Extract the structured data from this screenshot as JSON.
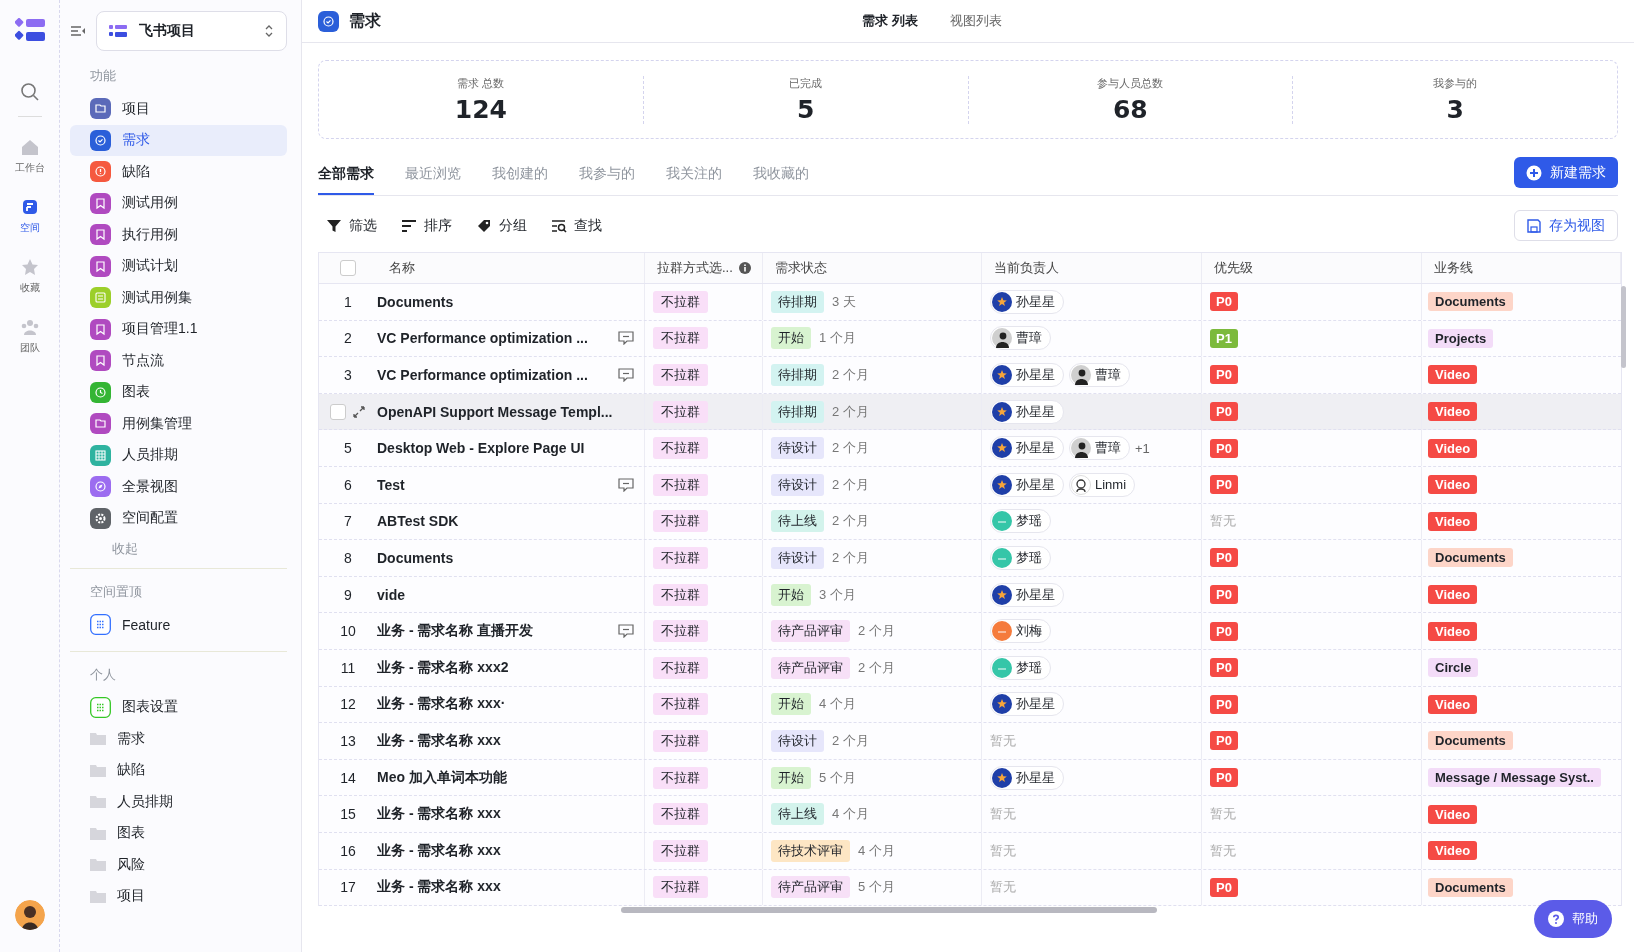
{
  "rail": {
    "items": [
      {
        "label": "工作台",
        "selected": false
      },
      {
        "label": "空间",
        "selected": true
      },
      {
        "label": "收藏",
        "selected": false
      },
      {
        "label": "团队",
        "selected": false
      }
    ]
  },
  "sidebar": {
    "project": "飞书项目",
    "sections": [
      {
        "title": "功能",
        "collapse": "收起",
        "items": [
          {
            "label": "项目",
            "kind": "badge",
            "color": "#5b6ab9",
            "selected": false
          },
          {
            "label": "需求",
            "kind": "badge",
            "color": "#2b5fd9",
            "selected": true
          },
          {
            "label": "缺陷",
            "kind": "badge",
            "color": "#f5593f",
            "selected": false
          },
          {
            "label": "测试用例",
            "kind": "badge",
            "color": "#b04ac0",
            "selected": false
          },
          {
            "label": "执行用例",
            "kind": "badge",
            "color": "#b04ac0",
            "selected": false
          },
          {
            "label": "测试计划",
            "kind": "badge",
            "color": "#b04ac0",
            "selected": false
          },
          {
            "label": "测试用例集",
            "kind": "badge",
            "color": "#9ccf2a",
            "selected": false
          },
          {
            "label": "项目管理1.1",
            "kind": "badge",
            "color": "#b04ac0",
            "selected": false
          },
          {
            "label": "节点流",
            "kind": "badge",
            "color": "#b04ac0",
            "selected": false
          },
          {
            "label": "图表",
            "kind": "badge",
            "color": "#34b534",
            "selected": false
          },
          {
            "label": "用例集管理",
            "kind": "badge",
            "color": "#b04ac0",
            "selected": false
          },
          {
            "label": "人员排期",
            "kind": "badge",
            "color": "#2fb3a0",
            "selected": false
          },
          {
            "label": "全景视图",
            "kind": "badge",
            "color": "#9c6cf0",
            "selected": false
          },
          {
            "label": "空间配置",
            "kind": "badge",
            "color": "#5f6368",
            "selected": false
          }
        ]
      },
      {
        "title": "空间置顶",
        "items": [
          {
            "label": "Feature",
            "kind": "list",
            "color": "#3370ff",
            "selected": false
          }
        ]
      },
      {
        "title": "个人",
        "items": [
          {
            "label": "图表设置",
            "kind": "list",
            "color": "#34c724",
            "selected": false
          },
          {
            "label": "需求",
            "kind": "folder",
            "selected": false
          },
          {
            "label": "缺陷",
            "kind": "folder",
            "selected": false
          },
          {
            "label": "人员排期",
            "kind": "folder",
            "selected": false
          },
          {
            "label": "图表",
            "kind": "folder",
            "selected": false
          },
          {
            "label": "风险",
            "kind": "folder",
            "selected": false
          },
          {
            "label": "项目",
            "kind": "folder",
            "selected": false
          }
        ]
      }
    ]
  },
  "header": {
    "title": "需求",
    "views": [
      {
        "label": "需求 列表",
        "selected": true
      },
      {
        "label": "视图列表",
        "selected": false
      }
    ]
  },
  "stats": [
    {
      "label": "需求 总数",
      "value": "124"
    },
    {
      "label": "已完成",
      "value": "5"
    },
    {
      "label": "参与人员总数",
      "value": "68"
    },
    {
      "label": "我参与的",
      "value": "3"
    }
  ],
  "tabs": [
    {
      "label": "全部需求",
      "selected": true
    },
    {
      "label": "最近浏览",
      "selected": false
    },
    {
      "label": "我创建的",
      "selected": false
    },
    {
      "label": "我参与的",
      "selected": false
    },
    {
      "label": "我关注的",
      "selected": false
    },
    {
      "label": "我收藏的",
      "selected": false
    }
  ],
  "new_button": "新建需求",
  "toolbar": {
    "tools": [
      "筛选",
      "排序",
      "分组",
      "查找"
    ],
    "save_view": "存为视图"
  },
  "table": {
    "all_checked": false,
    "columns": [
      {
        "label": "名称",
        "info": false
      },
      {
        "label": "拉群方式选...",
        "info": true
      },
      {
        "label": "需求状态",
        "info": false
      },
      {
        "label": "当前负责人",
        "info": false
      },
      {
        "label": "优先级",
        "info": false
      },
      {
        "label": "业务线",
        "info": false
      }
    ],
    "rows": [
      {
        "number": "1",
        "hovered": false,
        "name": "Documents",
        "comment": false,
        "group": "不拉群",
        "status": {
          "label": "待排期",
          "color": "#d3f3f1"
        },
        "duration": "3 天",
        "owners": [
          {
            "name": "孙星星",
            "kind": "star",
            "color": "#1f3fa8"
          }
        ],
        "priority": {
          "label": "P0",
          "kind": "p0"
        },
        "business": {
          "label": "Documents",
          "kind": "soft",
          "color": "#fdd5c8"
        }
      },
      {
        "number": "2",
        "hovered": false,
        "name": "VC Performance optimization ...",
        "comment": true,
        "group": "不拉群",
        "status": {
          "label": "开始",
          "color": "#d8f3d0"
        },
        "duration": "1 个月",
        "owners": [
          {
            "name": "曹璋",
            "kind": "photo",
            "color": "#cfcfcf"
          }
        ],
        "priority": {
          "label": "P1",
          "kind": "p1"
        },
        "business": {
          "label": "Projects",
          "kind": "soft",
          "color": "#f3dcf8"
        }
      },
      {
        "number": "3",
        "hovered": false,
        "name": "VC Performance optimization ...",
        "comment": true,
        "group": "不拉群",
        "status": {
          "label": "待排期",
          "color": "#d3f3f1"
        },
        "duration": "2 个月",
        "owners": [
          {
            "name": "孙星星",
            "kind": "star",
            "color": "#1f3fa8"
          },
          {
            "name": "曹璋",
            "kind": "photo",
            "color": "#cfcfcf"
          }
        ],
        "priority": {
          "label": "P0",
          "kind": "p0"
        },
        "business": {
          "label": "Video",
          "kind": "solid",
          "color": "#f54a45"
        }
      },
      {
        "hovered": true,
        "checked": false,
        "name": "OpenAPI Support Message Templ...",
        "comment": false,
        "group": "不拉群",
        "status": {
          "label": "待排期",
          "color": "#d3f3f1"
        },
        "duration": "2 个月",
        "owners": [
          {
            "name": "孙星星",
            "kind": "star",
            "color": "#1f3fa8"
          }
        ],
        "priority": {
          "label": "P0",
          "kind": "p0"
        },
        "business": {
          "label": "Video",
          "kind": "solid",
          "color": "#f54a45"
        }
      },
      {
        "number": "5",
        "hovered": false,
        "name": "Desktop Web - Explore Page UI",
        "comment": false,
        "group": "不拉群",
        "status": {
          "label": "待设计",
          "color": "#e6e6fb"
        },
        "duration": "2 个月",
        "owners": [
          {
            "name": "孙星星",
            "kind": "star",
            "color": "#1f3fa8"
          },
          {
            "name": "曹璋",
            "kind": "photo",
            "color": "#cfcfcf"
          }
        ],
        "more": "+1",
        "priority": {
          "label": "P0",
          "kind": "p0"
        },
        "business": {
          "label": "Video",
          "kind": "solid",
          "color": "#f54a45"
        }
      },
      {
        "number": "6",
        "hovered": false,
        "name": "Test",
        "comment": true,
        "group": "不拉群",
        "status": {
          "label": "待设计",
          "color": "#e6e6fb"
        },
        "duration": "2 个月",
        "owners": [
          {
            "name": "孙星星",
            "kind": "star",
            "color": "#1f3fa8"
          },
          {
            "name": "Linmi",
            "kind": "figure",
            "color": "#ffffff"
          }
        ],
        "priority": {
          "label": "P0",
          "kind": "p0"
        },
        "business": {
          "label": "Video",
          "kind": "solid",
          "color": "#f54a45"
        }
      },
      {
        "number": "7",
        "hovered": false,
        "name": "ABTest SDK",
        "comment": false,
        "group": "不拉群",
        "status": {
          "label": "待上线",
          "color": "#d3f3ec"
        },
        "duration": "2 个月",
        "owners": [
          {
            "name": "梦瑶",
            "kind": "plain",
            "color": "#35c6a8"
          }
        ],
        "priority": {
          "label": "暂无",
          "kind": "none"
        },
        "business": {
          "label": "Video",
          "kind": "solid",
          "color": "#f54a45"
        }
      },
      {
        "number": "8",
        "hovered": false,
        "name": "Documents",
        "comment": false,
        "group": "不拉群",
        "status": {
          "label": "待设计",
          "color": "#e6e6fb"
        },
        "duration": "2 个月",
        "owners": [
          {
            "name": "梦瑶",
            "kind": "plain",
            "color": "#35c6a8"
          }
        ],
        "priority": {
          "label": "P0",
          "kind": "p0"
        },
        "business": {
          "label": "Documents",
          "kind": "soft",
          "color": "#fdd5c8"
        }
      },
      {
        "number": "9",
        "hovered": false,
        "name": "vide",
        "comment": false,
        "group": "不拉群",
        "status": {
          "label": "开始",
          "color": "#d8f3d0"
        },
        "duration": "3 个月",
        "owners": [
          {
            "name": "孙星星",
            "kind": "star",
            "color": "#1f3fa8"
          }
        ],
        "priority": {
          "label": "P0",
          "kind": "p0"
        },
        "business": {
          "label": "Video",
          "kind": "solid",
          "color": "#f54a45"
        }
      },
      {
        "number": "10",
        "hovered": false,
        "name": "业务 - 需求名称 直播开发",
        "comment": true,
        "group": "不拉群",
        "status": {
          "label": "待产品评审",
          "color": "#f7e0f7"
        },
        "duration": "2 个月",
        "owners": [
          {
            "name": "刘梅",
            "kind": "plain",
            "color": "#f57b3c"
          }
        ],
        "priority": {
          "label": "P0",
          "kind": "p0"
        },
        "business": {
          "label": "Video",
          "kind": "solid",
          "color": "#f54a45"
        }
      },
      {
        "number": "11",
        "hovered": false,
        "name": "业务 - 需求名称 xxx2",
        "comment": false,
        "group": "不拉群",
        "status": {
          "label": "待产品评审",
          "color": "#f7e0f7"
        },
        "duration": "2 个月",
        "owners": [
          {
            "name": "梦瑶",
            "kind": "plain",
            "color": "#35c6a8"
          }
        ],
        "priority": {
          "label": "P0",
          "kind": "p0"
        },
        "business": {
          "label": "Circle",
          "kind": "soft",
          "color": "#f3dcf8"
        }
      },
      {
        "number": "12",
        "hovered": false,
        "name": "业务 - 需求名称 xxx·",
        "comment": false,
        "group": "不拉群",
        "status": {
          "label": "开始",
          "color": "#d8f3d0"
        },
        "duration": "4 个月",
        "owners": [
          {
            "name": "孙星星",
            "kind": "star",
            "color": "#1f3fa8"
          }
        ],
        "priority": {
          "label": "P0",
          "kind": "p0"
        },
        "business": {
          "label": "Video",
          "kind": "solid",
          "color": "#f54a45"
        }
      },
      {
        "number": "13",
        "hovered": false,
        "name": "业务 - 需求名称 xxx",
        "comment": false,
        "group": "不拉群",
        "status": {
          "label": "待设计",
          "color": "#e6e6fb"
        },
        "duration": "2 个月",
        "owner_empty": "暂无",
        "priority": {
          "label": "P0",
          "kind": "p0"
        },
        "business": {
          "label": "Documents",
          "kind": "soft",
          "color": "#fdd5c8"
        }
      },
      {
        "number": "14",
        "hovered": false,
        "name": "Meo 加入单词本功能",
        "comment": false,
        "group": "不拉群",
        "status": {
          "label": "开始",
          "color": "#d8f3d0"
        },
        "duration": "5 个月",
        "owners": [
          {
            "name": "孙星星",
            "kind": "star",
            "color": "#1f3fa8"
          }
        ],
        "priority": {
          "label": "P0",
          "kind": "p0"
        },
        "business": {
          "label": "Message / Message Syst..",
          "kind": "soft",
          "color": "#f3dcf8"
        }
      },
      {
        "number": "15",
        "hovered": false,
        "name": "业务 - 需求名称 xxx",
        "comment": false,
        "group": "不拉群",
        "status": {
          "label": "待上线",
          "color": "#d3f3ec"
        },
        "duration": "4 个月",
        "owner_empty": "暂无",
        "priority": {
          "label": "暂无",
          "kind": "none"
        },
        "business": {
          "label": "Video",
          "kind": "solid",
          "color": "#f54a45"
        }
      },
      {
        "number": "16",
        "hovered": false,
        "name": "业务 - 需求名称 xxx",
        "comment": false,
        "group": "不拉群",
        "status": {
          "label": "待技术评审",
          "color": "#fde6c4"
        },
        "duration": "4 个月",
        "owner_empty": "暂无",
        "priority": {
          "label": "暂无",
          "kind": "none"
        },
        "business": {
          "label": "Video",
          "kind": "solid",
          "color": "#f54a45"
        }
      },
      {
        "number": "17",
        "hovered": false,
        "name": "业务 - 需求名称 xxx",
        "comment": false,
        "group": "不拉群",
        "status": {
          "label": "待产品评审",
          "color": "#f7e0f7"
        },
        "duration": "5 个月",
        "owner_empty": "暂无",
        "priority": {
          "label": "P0",
          "kind": "p0"
        },
        "business": {
          "label": "Documents",
          "kind": "soft",
          "color": "#fdd5c8"
        }
      }
    ]
  },
  "help_button": "帮助"
}
